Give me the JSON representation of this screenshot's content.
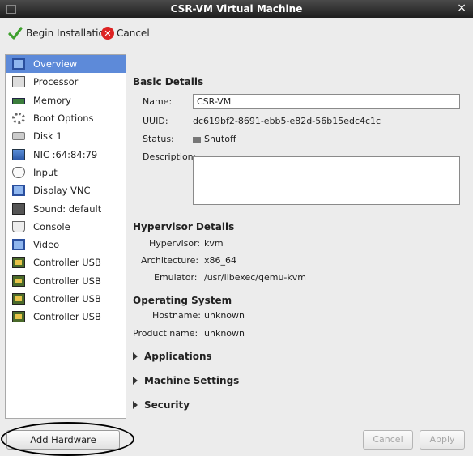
{
  "window": {
    "title": "CSR-VM Virtual Machine",
    "close_glyph": "×"
  },
  "toolbar": {
    "begin_label": "Begin Installation",
    "cancel_label": "Cancel"
  },
  "sidebar": {
    "items": [
      {
        "label": "Overview",
        "icon": "monitor-icon",
        "selected": true
      },
      {
        "label": "Processor",
        "icon": "processor-icon"
      },
      {
        "label": "Memory",
        "icon": "memory-icon"
      },
      {
        "label": "Boot Options",
        "icon": "boot-options-icon"
      },
      {
        "label": "Disk 1",
        "icon": "disk-icon"
      },
      {
        "label": "NIC :64:84:79",
        "icon": "nic-icon"
      },
      {
        "label": "Input",
        "icon": "mouse-icon"
      },
      {
        "label": "Display VNC",
        "icon": "display-icon"
      },
      {
        "label": "Sound: default",
        "icon": "sound-icon"
      },
      {
        "label": "Console",
        "icon": "console-icon"
      },
      {
        "label": "Video",
        "icon": "video-icon"
      },
      {
        "label": "Controller USB",
        "icon": "usb-controller-icon"
      },
      {
        "label": "Controller USB",
        "icon": "usb-controller-icon"
      },
      {
        "label": "Controller USB",
        "icon": "usb-controller-icon"
      },
      {
        "label": "Controller USB",
        "icon": "usb-controller-icon"
      }
    ],
    "add_hardware_label": "Add Hardware"
  },
  "basic": {
    "title": "Basic Details",
    "name_label": "Name:",
    "name_value": "CSR-VM",
    "uuid_label": "UUID:",
    "uuid_value": "dc619bf2-8691-ebb5-e82d-56b15edc4c1c",
    "status_label": "Status:",
    "status_value": "Shutoff",
    "description_label": "Description:"
  },
  "hypervisor": {
    "title": "Hypervisor Details",
    "hypervisor_label": "Hypervisor:",
    "hypervisor_value": "kvm",
    "arch_label": "Architecture:",
    "arch_value": "x86_64",
    "emulator_label": "Emulator:",
    "emulator_value": "/usr/libexec/qemu-kvm"
  },
  "os": {
    "title": "Operating System",
    "hostname_label": "Hostname:",
    "hostname_value": "unknown",
    "product_label": "Product name:",
    "product_value": "unknown"
  },
  "expanders": {
    "applications": "Applications",
    "machine_settings": "Machine Settings",
    "security": "Security"
  },
  "footer": {
    "cancel_label": "Cancel",
    "apply_label": "Apply"
  }
}
